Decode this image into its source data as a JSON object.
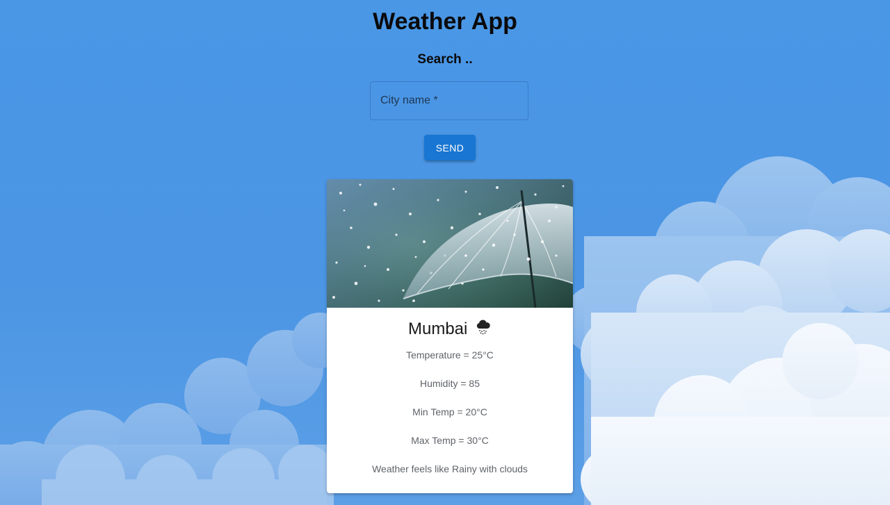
{
  "header": {
    "title": "Weather App",
    "subtitle": "Search .."
  },
  "search": {
    "label": "City name *",
    "value": "",
    "button_label": "SEND"
  },
  "card": {
    "image": "umbrella-in-rain",
    "city": "Mumbai",
    "condition_icon": "rain-cloud-icon",
    "temperature": "Temperature = 25°C",
    "humidity": "Humidity = 85",
    "min_temp": "Min Temp = 20°C",
    "max_temp": "Max Temp = 30°C",
    "feels_like": "Weather feels like Rainy with clouds"
  },
  "colors": {
    "background": "#4a97e6",
    "button": "#1976d2",
    "card": "#ffffff"
  }
}
